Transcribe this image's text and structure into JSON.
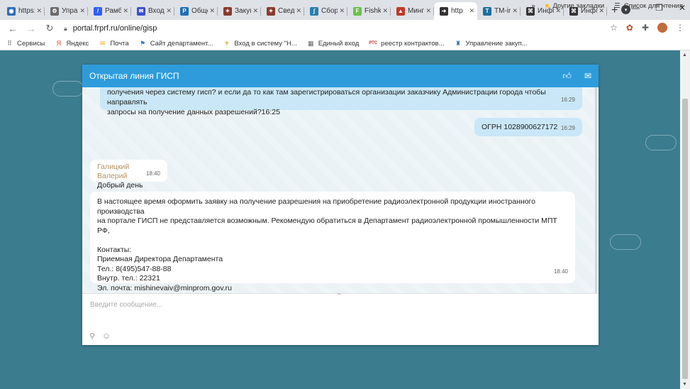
{
  "browser": {
    "tabs": [
      {
        "label": "https:/",
        "color": "#2b6fb8",
        "glyph": "◉"
      },
      {
        "label": "Управ",
        "color": "#6b6b6b",
        "glyph": "⚙"
      },
      {
        "label": "Рамбл",
        "color": "#315efb",
        "glyph": "/"
      },
      {
        "label": "Входя",
        "color": "#3a4fd1",
        "glyph": "✉"
      },
      {
        "label": "Общер",
        "color": "#1f6fb5",
        "glyph": "P"
      },
      {
        "label": "Закуп",
        "color": "#8a3b2b",
        "glyph": "✦"
      },
      {
        "label": "Сведен",
        "color": "#8a3b2b",
        "glyph": "✦"
      },
      {
        "label": "Сборн",
        "color": "#2a7fb0",
        "glyph": "∫"
      },
      {
        "label": "Fishki.n",
        "color": "#6cc04a",
        "glyph": "F"
      },
      {
        "label": "Минпр",
        "color": "#c0392b",
        "glyph": "▲"
      },
      {
        "label": "http",
        "color": "#333333",
        "glyph": "➜",
        "active": true
      },
      {
        "label": "TM-ind",
        "color": "#1a6fa0",
        "glyph": "T"
      },
      {
        "label": "Инфор",
        "color": "#333333",
        "glyph": "⌘"
      },
      {
        "label": "Инфор",
        "color": "#333333",
        "glyph": "⌘"
      }
    ],
    "new_tab": "+",
    "url": "portal.frprf.ru/online/gisp",
    "window": {
      "minimize": "—",
      "maximize": "❐",
      "close": "✕"
    }
  },
  "bookmarks": {
    "items": [
      {
        "label": "Сервисы",
        "glyph": "⠿",
        "color": "#555555"
      },
      {
        "label": "Яндекс",
        "glyph": "Я",
        "color": "#e8412c"
      },
      {
        "label": "Почта",
        "glyph": "✉",
        "color": "#f0a020"
      },
      {
        "label": "Сайт департамент...",
        "glyph": "⚑",
        "color": "#3b7fc4"
      },
      {
        "label": "Вход в систему \"Н...",
        "glyph": "⚜",
        "color": "#c9a227"
      },
      {
        "label": "Единый вход",
        "glyph": "▦",
        "color": "#666666"
      },
      {
        "label": "реестр контрактов...",
        "glyph": "РТС",
        "color": "#d02c2c"
      },
      {
        "label": "Управление закуп...",
        "glyph": "♜",
        "color": "#2a6db0"
      }
    ],
    "more": "»",
    "other": "Другие закладки",
    "reading_list": "Список для чтения"
  },
  "chat": {
    "title": "Открытая линия ГИСП",
    "messages": [
      {
        "lines": [
          "получения через систему гисп? и если да то как там зарегистрироваться организации заказчику Администрации города чтобы направлять",
          "запросы на получение данных разрешений?16:25"
        ],
        "time": "16:29"
      },
      {
        "text": "ОГРН 1028900627172",
        "time": "16:29"
      },
      {
        "author": "Галицкий Валерий",
        "text": "Добрый день",
        "time": "18:40"
      },
      {
        "lines": [
          "В настоящее время оформить заявку на получение разрешения на приобретение радиоэлектронной продукции иностранного производства",
          "на портале ГИСП не представляется возможным. Рекомендую обратиться в Департамент радиоэлектронной промышленности МПТ РФ,",
          "",
          "Контакты:",
          "Приемная Директора Департамента",
          "Тел.: 8(495)547-88-88",
          "Внутр. тел.: 22321",
          "Эл. почта: mishinevaiv@minprom.gov.ru"
        ],
        "time": "18:40"
      }
    ],
    "input_placeholder": "Введите сообщение..."
  }
}
